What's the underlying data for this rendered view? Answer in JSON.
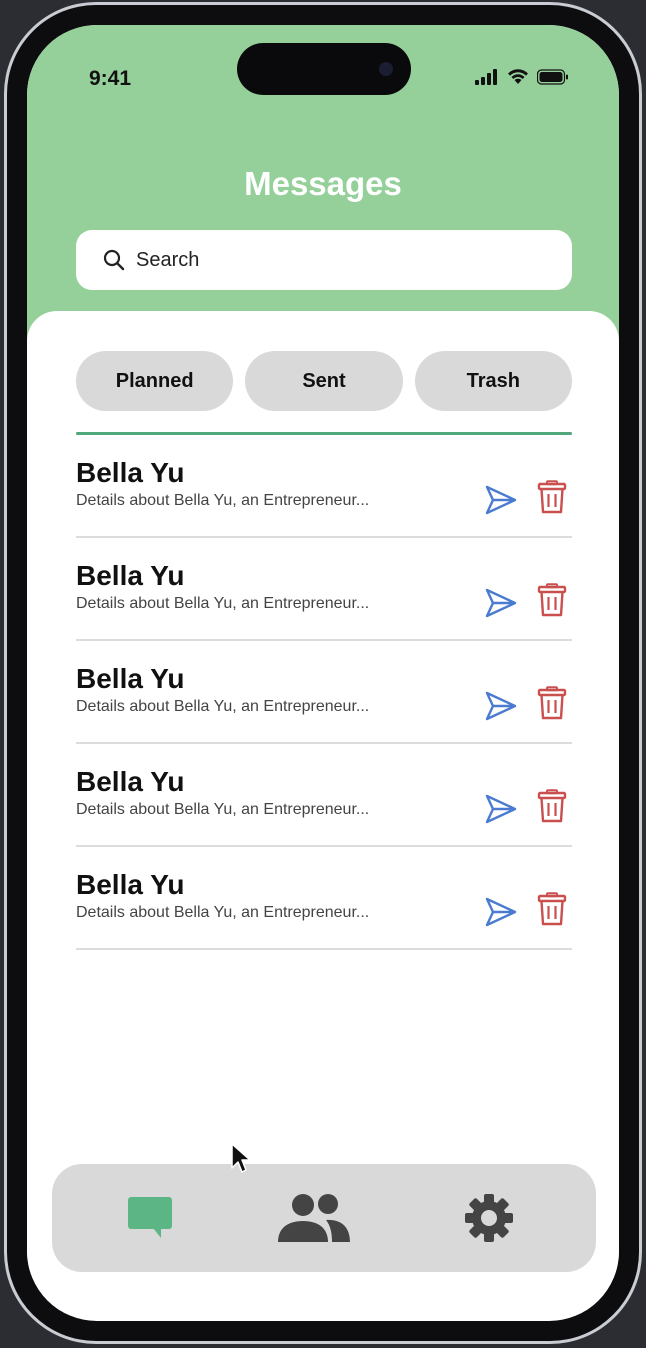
{
  "status_bar": {
    "time": "9:41"
  },
  "header": {
    "title": "Messages"
  },
  "search": {
    "placeholder": "Search"
  },
  "tabs": [
    {
      "label": "Planned"
    },
    {
      "label": "Sent"
    },
    {
      "label": "Trash"
    }
  ],
  "messages": [
    {
      "name": "Bella Yu",
      "details": "Details about Bella Yu, an Entrepreneur..."
    },
    {
      "name": "Bella Yu",
      "details": "Details about Bella Yu, an Entrepreneur..."
    },
    {
      "name": "Bella Yu",
      "details": "Details about Bella Yu, an Entrepreneur..."
    },
    {
      "name": "Bella Yu",
      "details": "Details about Bella Yu, an Entrepreneur..."
    },
    {
      "name": "Bella Yu",
      "details": "Details about Bella Yu, an Entrepreneur..."
    }
  ],
  "bottom_nav": {
    "items": [
      {
        "icon": "chat-bubble-icon",
        "active": true
      },
      {
        "icon": "people-icon",
        "active": false
      },
      {
        "icon": "gear-icon",
        "active": false
      }
    ]
  },
  "colors": {
    "header_green": "#95d09a",
    "accent_green": "#4fa77b",
    "send_blue": "#4a7bd0",
    "trash_red": "#c9504f",
    "nav_gray": "#d9d9d9"
  }
}
